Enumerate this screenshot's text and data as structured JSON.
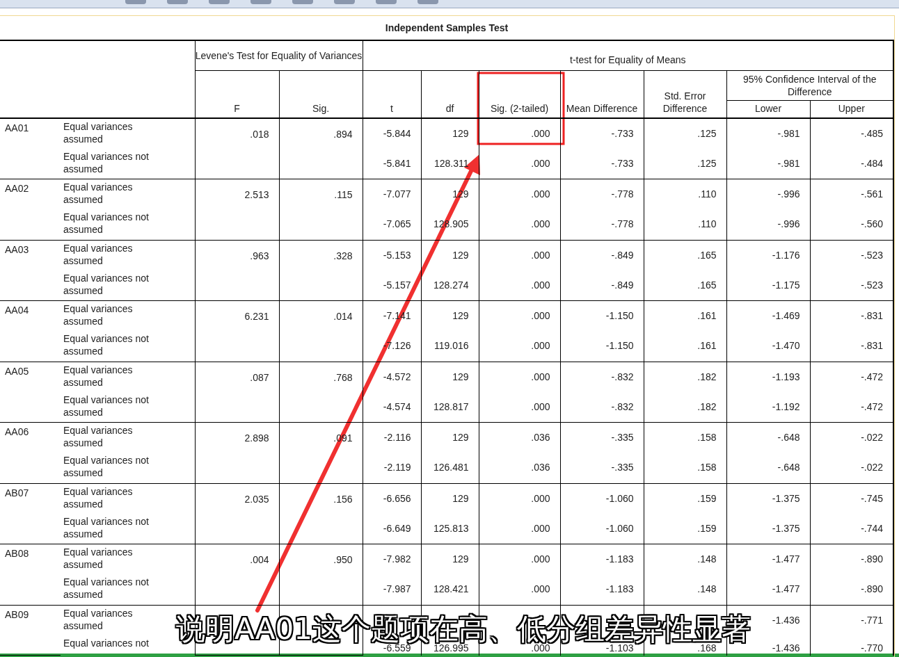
{
  "title": "Independent Samples Test",
  "header": {
    "levene": "Levene's Test for Equality of Variances",
    "ttest": "t-test for Equality of Means",
    "columns": [
      "F",
      "Sig.",
      "t",
      "df",
      "Sig. (2-tailed)",
      "Mean Difference",
      "Std. Error Difference"
    ],
    "ci": "95% Confidence Interval of the Difference",
    "ci_columns": [
      "Lower",
      "Upper"
    ]
  },
  "groups": [
    {
      "code": "AA01",
      "rows": [
        {
          "label": "Equal variances assumed",
          "f": ".018",
          "sig": ".894",
          "values": [
            "-5.844",
            "129",
            ".000",
            "-.733",
            ".125",
            "-.981",
            "-.485"
          ]
        },
        {
          "label": "Equal variances not assumed",
          "values": [
            "-5.841",
            "128.311",
            ".000",
            "-.733",
            ".125",
            "-.981",
            "-.484"
          ]
        }
      ]
    },
    {
      "code": "AA02",
      "rows": [
        {
          "label": "Equal variances assumed",
          "f": "2.513",
          "sig": ".115",
          "values": [
            "-7.077",
            "129",
            ".000",
            "-.778",
            ".110",
            "-.996",
            "-.561"
          ]
        },
        {
          "label": "Equal variances not assumed",
          "values": [
            "-7.065",
            "128.905",
            ".000",
            "-.778",
            ".110",
            "-.996",
            "-.560"
          ]
        }
      ]
    },
    {
      "code": "AA03",
      "rows": [
        {
          "label": "Equal variances assumed",
          "f": ".963",
          "sig": ".328",
          "values": [
            "-5.153",
            "129",
            ".000",
            "-.849",
            ".165",
            "-1.176",
            "-.523"
          ]
        },
        {
          "label": "Equal variances not assumed",
          "values": [
            "-5.157",
            "128.274",
            ".000",
            "-.849",
            ".165",
            "-1.175",
            "-.523"
          ]
        }
      ]
    },
    {
      "code": "AA04",
      "rows": [
        {
          "label": "Equal variances assumed",
          "f": "6.231",
          "sig": ".014",
          "values": [
            "-7.141",
            "129",
            ".000",
            "-1.150",
            ".161",
            "-1.469",
            "-.831"
          ]
        },
        {
          "label": "Equal variances not assumed",
          "values": [
            "-7.126",
            "119.016",
            ".000",
            "-1.150",
            ".161",
            "-1.470",
            "-.831"
          ]
        }
      ]
    },
    {
      "code": "AA05",
      "rows": [
        {
          "label": "Equal variances assumed",
          "f": ".087",
          "sig": ".768",
          "values": [
            "-4.572",
            "129",
            ".000",
            "-.832",
            ".182",
            "-1.193",
            "-.472"
          ]
        },
        {
          "label": "Equal variances not assumed",
          "values": [
            "-4.574",
            "128.817",
            ".000",
            "-.832",
            ".182",
            "-1.192",
            "-.472"
          ]
        }
      ]
    },
    {
      "code": "AA06",
      "rows": [
        {
          "label": "Equal variances assumed",
          "f": "2.898",
          "sig": ".091",
          "values": [
            "-2.116",
            "129",
            ".036",
            "-.335",
            ".158",
            "-.648",
            "-.022"
          ]
        },
        {
          "label": "Equal variances not assumed",
          "values": [
            "-2.119",
            "126.481",
            ".036",
            "-.335",
            ".158",
            "-.648",
            "-.022"
          ]
        }
      ]
    },
    {
      "code": "AB07",
      "rows": [
        {
          "label": "Equal variances assumed",
          "f": "2.035",
          "sig": ".156",
          "values": [
            "-6.656",
            "129",
            ".000",
            "-1.060",
            ".159",
            "-1.375",
            "-.745"
          ]
        },
        {
          "label": "Equal variances not assumed",
          "values": [
            "-6.649",
            "125.813",
            ".000",
            "-1.060",
            ".159",
            "-1.375",
            "-.744"
          ]
        }
      ]
    },
    {
      "code": "AB08",
      "rows": [
        {
          "label": "Equal variances assumed",
          "f": ".004",
          "sig": ".950",
          "values": [
            "-7.982",
            "129",
            ".000",
            "-1.183",
            ".148",
            "-1.477",
            "-.890"
          ]
        },
        {
          "label": "Equal variances not assumed",
          "values": [
            "-7.987",
            "128.421",
            ".000",
            "-1.183",
            ".148",
            "-1.477",
            "-.890"
          ]
        }
      ]
    },
    {
      "code": "AB09",
      "rows": [
        {
          "label": "Equal variances assumed",
          "partial": {
            "lower": "-1.436",
            "upper": "-.771"
          }
        },
        {
          "label": "Equal variances not",
          "values": [
            "-6.559",
            "126.995",
            ".000",
            "-1.103",
            ".168",
            "-1.436",
            "-.770"
          ]
        }
      ]
    }
  ],
  "caption": "说明AA01这个题项在高、低分组差异性显著"
}
